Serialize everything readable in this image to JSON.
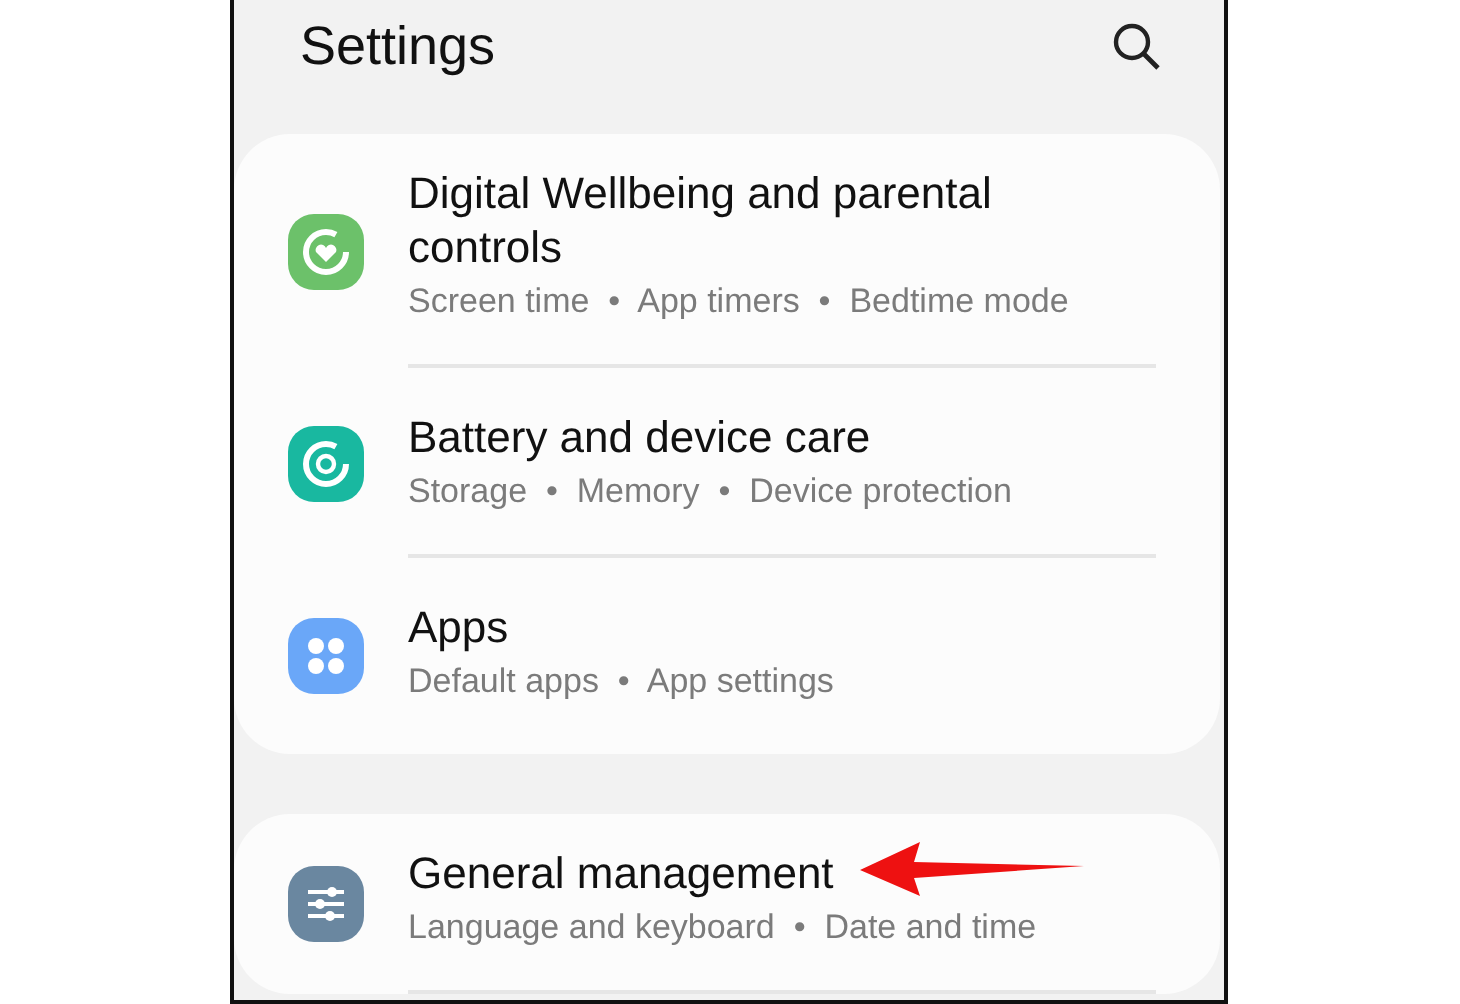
{
  "header": {
    "title": "Settings"
  },
  "groups": [
    {
      "items": [
        {
          "title": "Digital Wellbeing and parental controls",
          "subtitle": "Screen time  •  App timers  •  Bedtime mode",
          "color": "#6cc16a"
        },
        {
          "title": "Battery and device care",
          "subtitle": "Storage  •  Memory  •  Device protection",
          "color": "#19b8a0"
        },
        {
          "title": "Apps",
          "subtitle": "Default apps  •  App settings",
          "color": "#6aa7f8"
        }
      ]
    },
    {
      "items": [
        {
          "title": "General management",
          "subtitle": "Language and keyboard  •  Date and time",
          "color": "#6a87a0"
        }
      ]
    }
  ]
}
